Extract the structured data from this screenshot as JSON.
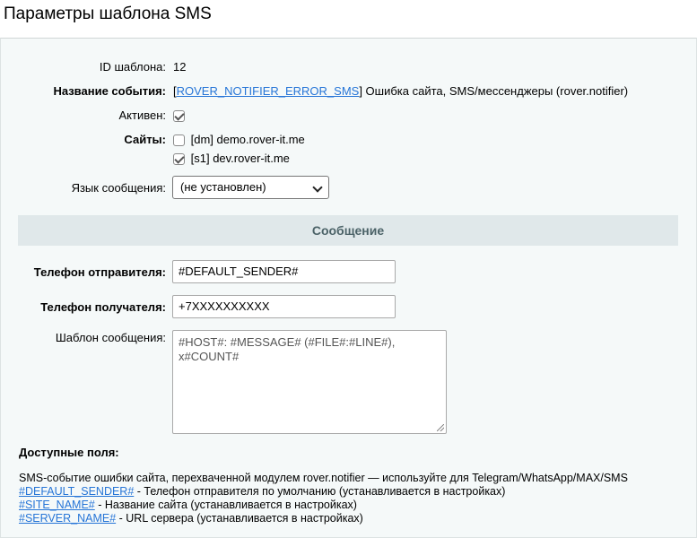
{
  "page": {
    "title": "Параметры шаблона SMS"
  },
  "form": {
    "id_label": "ID шаблона:",
    "id_value": "12",
    "event_label": "Название события:",
    "event_bracket_open": "[",
    "event_code": "ROVER_NOTIFIER_ERROR_SMS",
    "event_rest": "] Ошибка сайта, SMS/мессенджеры (rover.notifier)",
    "active_label": "Активен:",
    "active_checked": true,
    "sites_label": "Сайты:",
    "sites": [
      {
        "label": "[dm] demo.rover-it.me",
        "checked": false
      },
      {
        "label": "[s1] dev.rover-it.me",
        "checked": true
      }
    ],
    "language_label": "Язык сообщения:",
    "language_value": "(не установлен)"
  },
  "message_section": {
    "title": "Сообщение",
    "sender_label": "Телефон отправителя:",
    "sender_value": "#DEFAULT_SENDER#",
    "receiver_label": "Телефон получателя:",
    "receiver_value": "+7XXXXXXXXXX",
    "template_label": "Шаблон сообщения:",
    "template_value": "#HOST#: #MESSAGE# (#FILE#:#LINE#),\nx#COUNT#"
  },
  "available_fields": {
    "title": "Доступные поля:",
    "description": "SMS-событие ошибки сайта, перехваченной модулем rover.notifier — используйте для Telegram/WhatsApp/MAX/SMS",
    "items": [
      {
        "code": "#DEFAULT_SENDER#",
        "text": " - Телефон отправителя по умолчанию (устанавливается в настройках)"
      },
      {
        "code": "#SITE_NAME#",
        "text": " - Название сайта (устанавливается в настройках)"
      },
      {
        "code": "#SERVER_NAME#",
        "text": " - URL сервера (устанавливается в настройках)"
      }
    ]
  }
}
